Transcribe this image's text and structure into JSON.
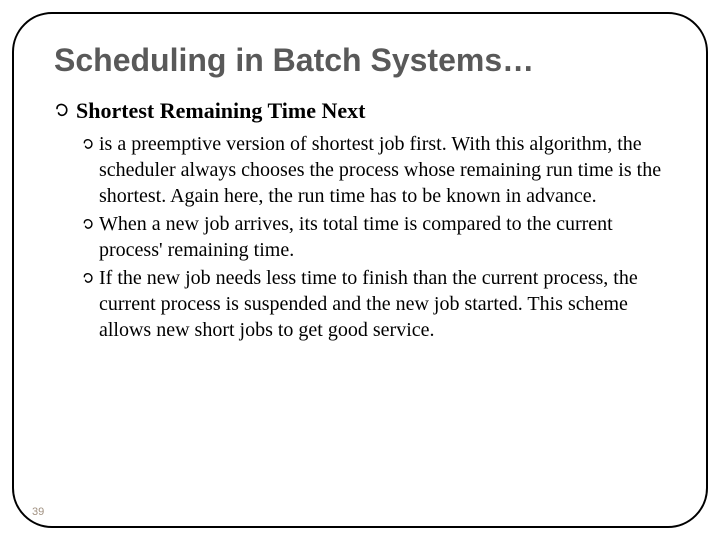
{
  "slide": {
    "title": "Scheduling in Batch Systems…",
    "subhead": "Shortest Remaining Time Next",
    "bullets": [
      "is a preemptive version of shortest job first. With this algorithm, the scheduler always chooses the process whose remaining run time is the shortest. Again here, the run time has to be known in advance.",
      "When a new job arrives, its total time is compared to the current process' remaining time.",
      "If the new job needs less time to finish than the current process, the current process is suspended and the new job started. This scheme allows new short jobs to get good service."
    ],
    "slide_number": "39"
  }
}
